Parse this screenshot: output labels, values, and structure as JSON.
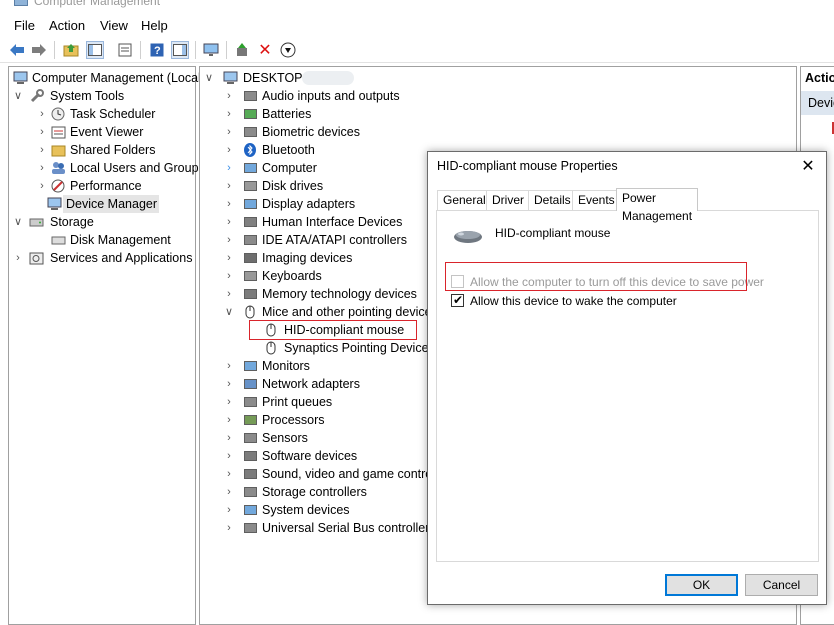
{
  "window": {
    "title": "Computer Management"
  },
  "menu": [
    "File",
    "Action",
    "View",
    "Help"
  ],
  "toolbar_icons": [
    "back-arrow-icon",
    "forward-arrow-icon",
    "up-folder-icon",
    "console-tree-icon",
    "properties-icon",
    "help-icon",
    "action-pane-icon",
    "monitor-icon",
    "update-driver-icon",
    "uninstall-icon",
    "disable-device-icon"
  ],
  "left_tree": {
    "root": "Computer Management (Local",
    "items": [
      {
        "label": "System Tools",
        "level": 1,
        "expanded": true
      },
      {
        "label": "Task Scheduler",
        "level": 2
      },
      {
        "label": "Event Viewer",
        "level": 2
      },
      {
        "label": "Shared Folders",
        "level": 2
      },
      {
        "label": "Local Users and Groups",
        "level": 2
      },
      {
        "label": "Performance",
        "level": 2
      },
      {
        "label": "Device Manager",
        "level": 2,
        "selected": true
      },
      {
        "label": "Storage",
        "level": 1,
        "expanded": true
      },
      {
        "label": "Disk Management",
        "level": 2
      },
      {
        "label": "Services and Applications",
        "level": 1
      }
    ]
  },
  "device_tree": {
    "root": "DESKTOP-",
    "categories": [
      "Audio inputs and outputs",
      "Batteries",
      "Biometric devices",
      "Bluetooth",
      "Computer",
      "Disk drives",
      "Display adapters",
      "Human Interface Devices",
      "IDE ATA/ATAPI controllers",
      "Imaging devices",
      "Keyboards",
      "Memory technology devices",
      "Mice and other pointing devices",
      "HID-compliant mouse",
      "Synaptics Pointing Device",
      "Monitors",
      "Network adapters",
      "Print queues",
      "Processors",
      "Sensors",
      "Software devices",
      "Sound, video and game controllers",
      "Storage controllers",
      "System devices",
      "Universal Serial Bus controllers"
    ]
  },
  "actions_pane": {
    "header": "Actio",
    "item": "Devic"
  },
  "dialog": {
    "title": "HID-compliant mouse Properties",
    "tabs": [
      "General",
      "Driver",
      "Details",
      "Events",
      "Power Management"
    ],
    "active_tab": "Power Management",
    "device_name": "HID-compliant mouse",
    "option_turn_off": "Allow the computer to turn off this device to save power",
    "option_turn_off_checked": false,
    "option_turn_off_enabled": false,
    "option_wake": "Allow this device to wake the computer",
    "option_wake_checked": true,
    "ok": "OK",
    "cancel": "Cancel"
  },
  "colors": {
    "highlight_red": "#d9242b",
    "primary_blue": "#0078d7",
    "selection_gray": "#e5e5e5"
  }
}
